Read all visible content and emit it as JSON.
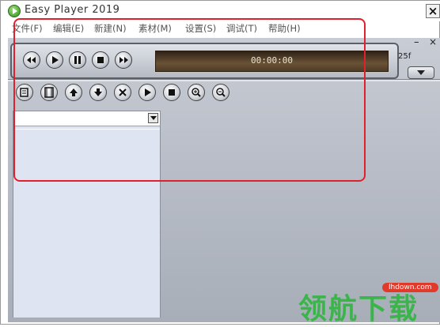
{
  "window": {
    "title": "Easy Player 2019",
    "close_label": "×"
  },
  "menu": {
    "items": [
      "文件(F)",
      "编辑(E)",
      "新建(N)",
      "素材(M)",
      "设置(S)",
      "调试(T)",
      "帮助(H)"
    ]
  },
  "transport": {
    "time_display": "00:00:00",
    "fps_label": "25f",
    "minimize_label": "–",
    "close_label": "×",
    "buttons": [
      "rewind-icon",
      "play-icon",
      "pause-icon",
      "stop-icon",
      "fast-forward-icon"
    ]
  },
  "toolbar": {
    "buttons": [
      "script-icon",
      "film-icon",
      "up-icon",
      "down-icon",
      "delete-icon",
      "play-icon",
      "stop-icon",
      "zoom-in-icon",
      "zoom-out-icon"
    ]
  },
  "left_pane": {
    "combo_value": ""
  },
  "watermark": {
    "badge": "lhdown.com",
    "text": "领航下载"
  },
  "colors": {
    "highlight_box": "#e0202a",
    "panel": "#b8bdc7",
    "display_bg": "#4e3c26",
    "watermark_green": "#3ab54a"
  }
}
